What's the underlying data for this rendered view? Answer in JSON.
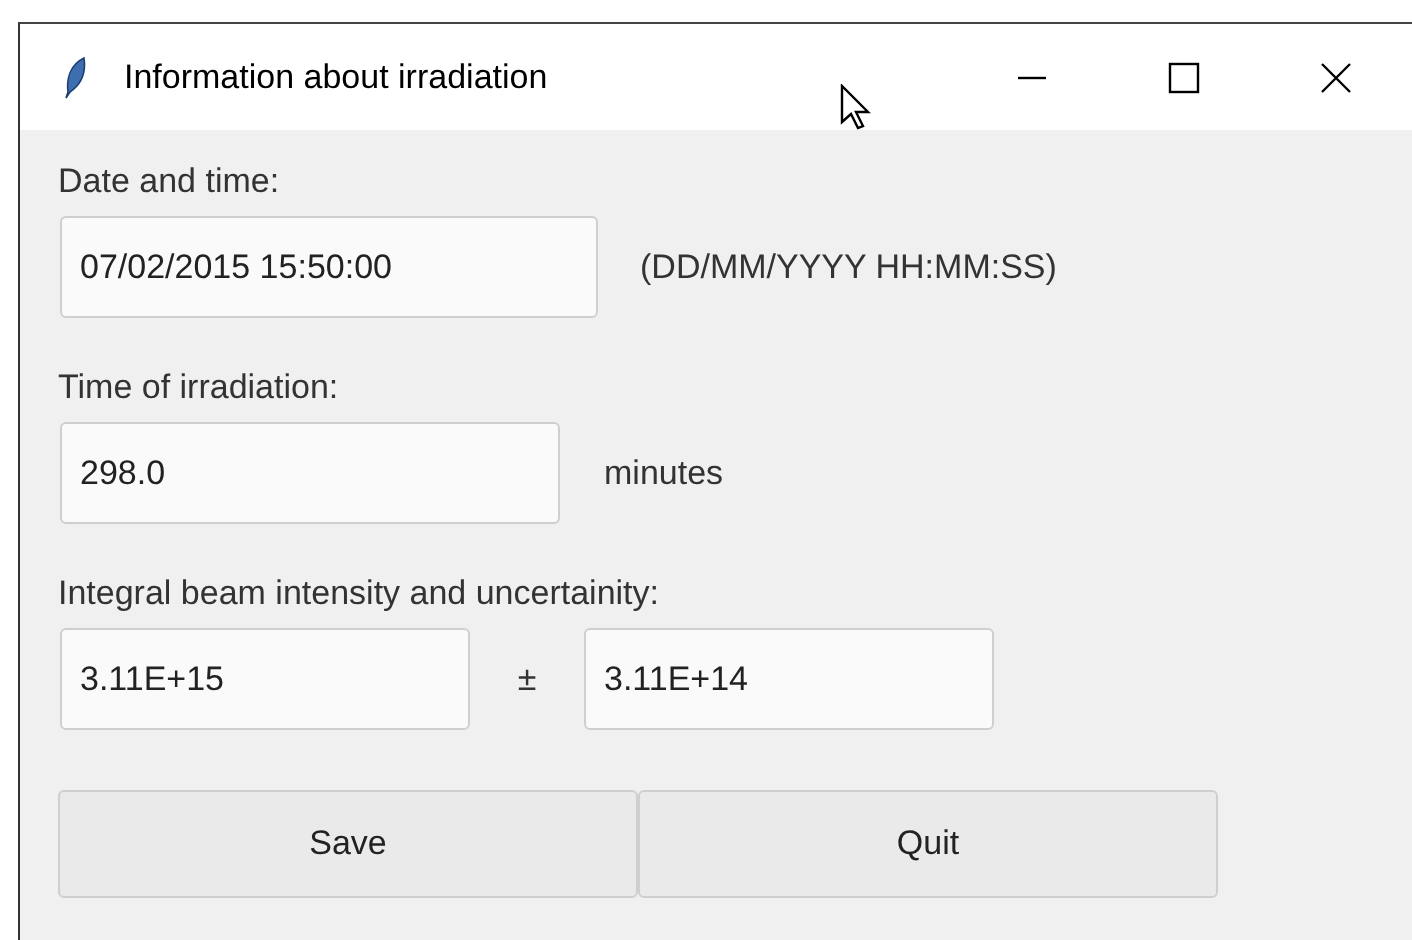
{
  "window": {
    "title": "Information about irradiation"
  },
  "date": {
    "label": "Date and time:",
    "value": "07/02/2015 15:50:00",
    "hint": "(DD/MM/YYYY HH:MM:SS)"
  },
  "time": {
    "label": "Time of irradiation:",
    "value": "298.0",
    "unit": "minutes"
  },
  "intensity": {
    "label": "Integral beam intensity and uncertainity:",
    "value": "3.11E+15",
    "separator": "±",
    "uncertainty": "3.11E+14"
  },
  "buttons": [
    "Save",
    "Quit"
  ]
}
